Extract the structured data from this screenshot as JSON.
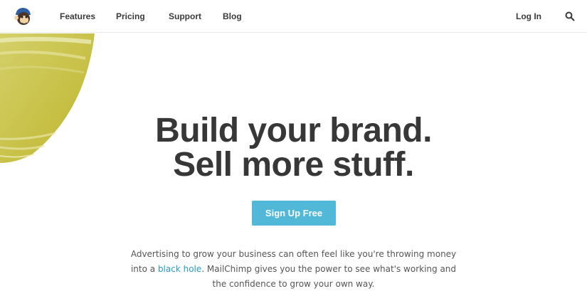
{
  "nav": {
    "links": [
      "Features",
      "Pricing",
      "Support",
      "Blog"
    ],
    "login": "Log In"
  },
  "hero": {
    "title_line1": "Build your brand.",
    "title_line2": "Sell more stuff.",
    "cta": "Sign Up Free"
  },
  "description": {
    "part1": "Advertising to grow your business can often feel like you're throwing money into a ",
    "link": "black hole",
    "part2": ". MailChimp gives you the power to see what's working and the confidence to grow your own way."
  },
  "icons": {
    "logo": "mailchimp-logo-icon",
    "search": "search-icon"
  },
  "colors": {
    "accent": "#52b8d8",
    "link": "#2a9bc2",
    "decor": "#c8c13c"
  }
}
